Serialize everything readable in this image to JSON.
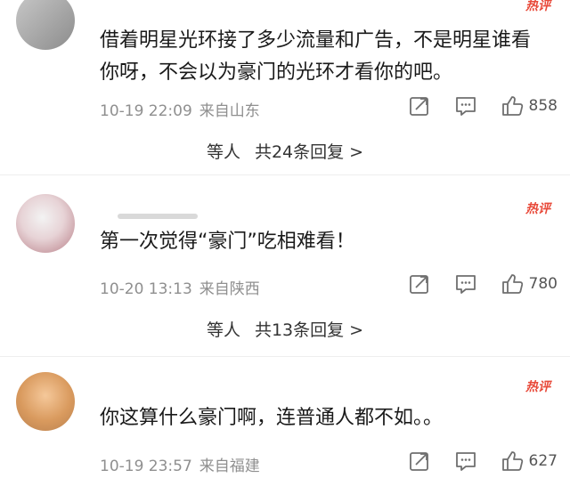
{
  "comments": [
    {
      "badge": "热评",
      "text": "借着明星光环接了多少流量和广告，不是明星谁看你呀，不会以为豪门的光环才看你的吧。",
      "time": "10-19 22:09",
      "location": "来自山东",
      "likes": "858",
      "replies_prefix": "等人",
      "replies_text": "共24条回复",
      "arrow": ">"
    },
    {
      "badge": "热评",
      "text": "第一次觉得“豪门”吃相难看！",
      "time": "10-20 13:13",
      "location": "来自陕西",
      "likes": "780",
      "replies_prefix": "等人",
      "replies_text": "共13条回复",
      "arrow": ">"
    },
    {
      "badge": "热评",
      "text": "你这算什么豪门啊，连普通人都不如。。",
      "time": "10-19 23:57",
      "location": "来自福建",
      "likes": "627"
    }
  ],
  "icons": {
    "share": "share-icon",
    "comment": "comment-icon",
    "like": "thumb-up-icon"
  },
  "colors": {
    "badge": "#e84a3a",
    "meta": "#8f8f8f",
    "text": "#1a1a1a"
  }
}
